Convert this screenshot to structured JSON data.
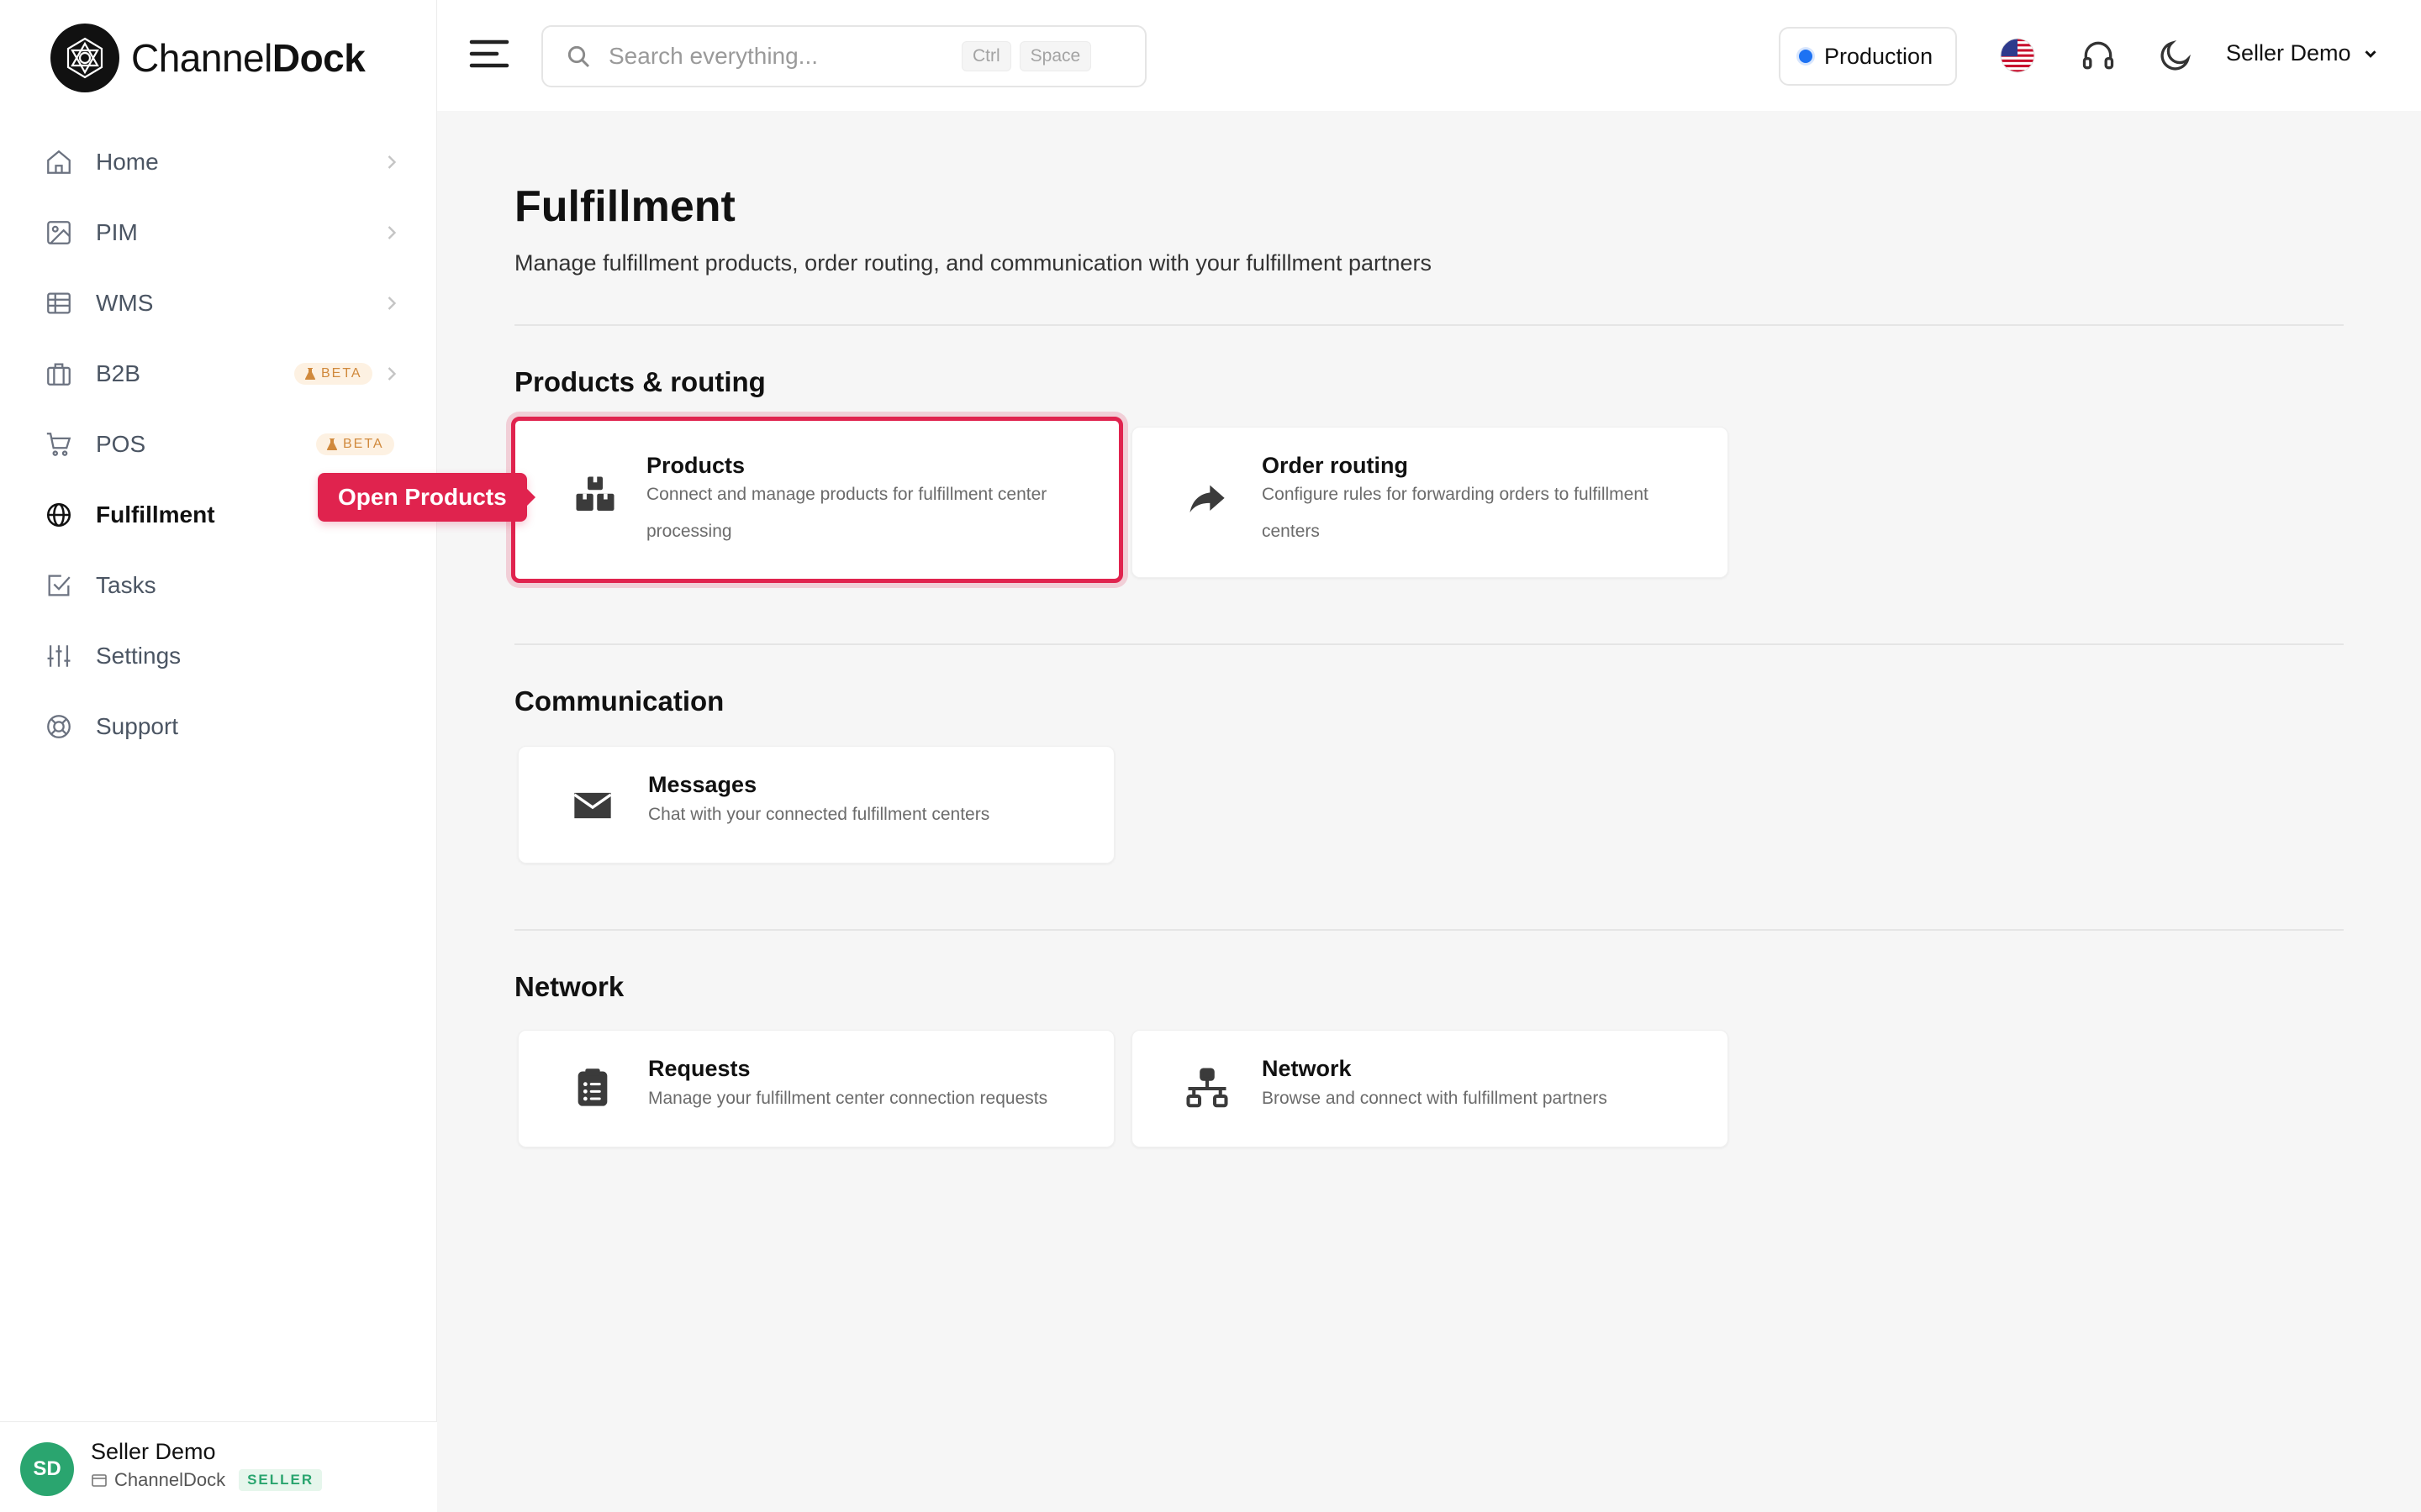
{
  "brand": {
    "name_light": "Channel",
    "name_bold": "Dock"
  },
  "header": {
    "search_placeholder": "Search everything...",
    "shortcut_keys": [
      "Ctrl",
      "Space"
    ],
    "environment": "Production",
    "account": "Seller Demo"
  },
  "sidebar": {
    "items": [
      {
        "label": "Home",
        "icon": "home-icon",
        "chevron": true
      },
      {
        "label": "PIM",
        "icon": "image-icon",
        "chevron": true
      },
      {
        "label": "WMS",
        "icon": "grid-icon",
        "chevron": true
      },
      {
        "label": "B2B",
        "icon": "briefcase-icon",
        "chevron": true,
        "badge": "BETA"
      },
      {
        "label": "POS",
        "icon": "cart-icon",
        "chevron": false,
        "badge": "BETA"
      },
      {
        "label": "Fulfillment",
        "icon": "globe-icon",
        "chevron": false,
        "active": true
      },
      {
        "label": "Tasks",
        "icon": "checkbox-icon",
        "chevron": false
      },
      {
        "label": "Settings",
        "icon": "sliders-icon",
        "chevron": false
      },
      {
        "label": "Support",
        "icon": "lifebuoy-icon",
        "chevron": false
      }
    ],
    "tooltip": "Open Products",
    "user": {
      "initials": "SD",
      "name": "Seller Demo",
      "org": "ChannelDock",
      "role": "SELLER"
    }
  },
  "main": {
    "title": "Fulfillment",
    "subtitle": "Manage fulfillment products, order routing, and communication with your fulfillment partners",
    "sections": [
      {
        "title": "Products & routing",
        "cards": [
          {
            "title": "Products",
            "description": "Connect and manage products for fulfillment center processing",
            "icon": "boxes-icon"
          },
          {
            "title": "Order routing",
            "description": "Configure rules for forwarding orders to fulfillment centers",
            "icon": "share-arrow-icon"
          }
        ]
      },
      {
        "title": "Communication",
        "cards": [
          {
            "title": "Messages",
            "description": "Chat with your connected fulfillment centers",
            "icon": "envelope-icon"
          }
        ]
      },
      {
        "title": "Network",
        "cards": [
          {
            "title": "Requests",
            "description": "Manage your fulfillment center connection requests",
            "icon": "clipboard-list-icon"
          },
          {
            "title": "Network",
            "description": "Browse and connect with fulfillment partners",
            "icon": "network-icon"
          }
        ]
      }
    ]
  },
  "colors": {
    "accent": "#e0234e",
    "environment_dot": "#1d72f3",
    "avatar": "#2aa56f",
    "beta": "#d0893c"
  }
}
